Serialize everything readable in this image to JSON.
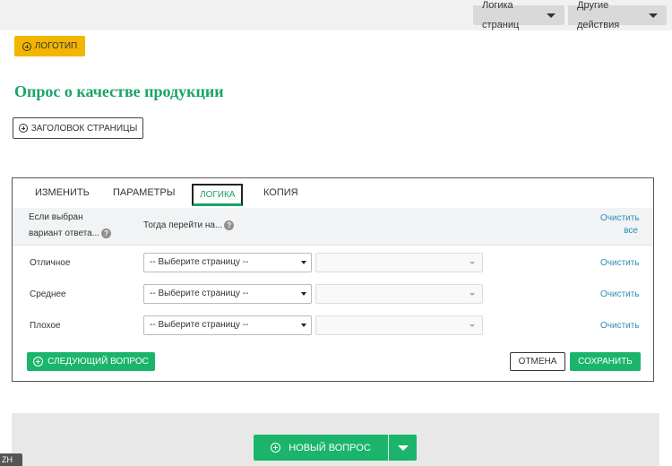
{
  "topbar": {
    "page_logic_label": "Логика страниц",
    "other_actions_label": "Другие действия"
  },
  "logo_button": {
    "label": "ЛОГОТИП"
  },
  "survey_title": "Опрос о качестве продукции",
  "page_header_button": {
    "label": "ЗАГОЛОВОК СТРАНИЦЫ"
  },
  "panel": {
    "tabs": [
      {
        "label": "ИЗМЕНИТЬ",
        "active": false
      },
      {
        "label": "ПАРАМЕТРЫ",
        "active": false
      },
      {
        "label": "ЛОГИКА",
        "active": true
      },
      {
        "label": "КОПИЯ",
        "active": false
      }
    ],
    "header": {
      "if_selected_line1": "Если выбран",
      "if_selected_line2": "вариант ответа...",
      "then_go": "Тогда перейти на...",
      "clear_all_line1": "Очистить",
      "clear_all_line2": "все",
      "help_glyph": "?"
    },
    "rows": [
      {
        "label": "Отличное",
        "page_select": "-- Выберите страницу --",
        "clear": "Очистить"
      },
      {
        "label": "Среднее",
        "page_select": "-- Выберите страницу --",
        "clear": "Очистить"
      },
      {
        "label": "Плохое",
        "page_select": "-- Выберите страницу --",
        "clear": "Очистить"
      }
    ],
    "next_question_label": "СЛЕДУЮЩИЙ ВОПРОС",
    "cancel_label": "ОТМЕНА",
    "save_label": "СОХРАНИТЬ"
  },
  "bottom": {
    "new_question_label": "НОВЫЙ ВОПРОС"
  },
  "lang_badge": "ZH",
  "colors": {
    "accent_green": "#1ab56a",
    "title_green": "#1aa36a",
    "logo_yellow": "#f2b600",
    "link_blue": "#2a8fb4"
  },
  "icons": [
    "plus-circle-icon",
    "caret-down-icon",
    "help-icon"
  ]
}
